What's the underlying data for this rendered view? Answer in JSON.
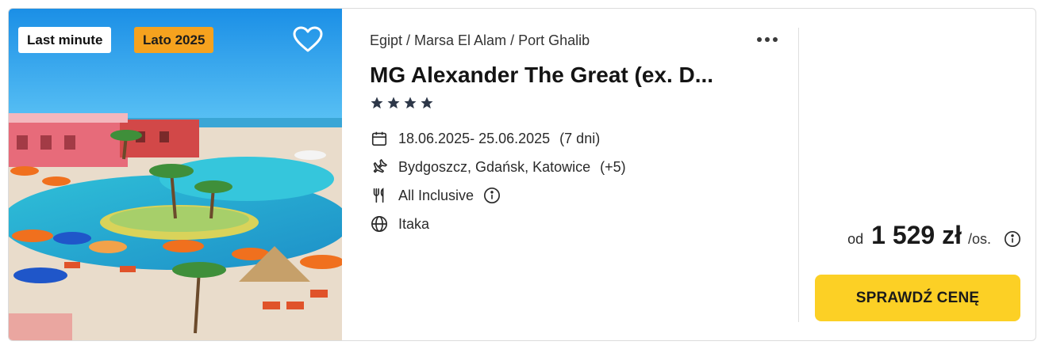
{
  "badges": {
    "last_minute": "Last minute",
    "season": "Lato 2025"
  },
  "colors": {
    "season_badge": "#f6a21e",
    "cta": "#fcd025",
    "stars": "#2d3748"
  },
  "breadcrumb": "Egipt / Marsa El Alam / Port Ghalib",
  "hotel": {
    "name": "MG Alexander The Great (ex. D...",
    "stars": 4
  },
  "dates": {
    "range": "18.06.2025- 25.06.2025",
    "duration": "(7 dni)"
  },
  "airports": {
    "list": "Bydgoszcz, Gdańsk, Katowice",
    "more": "(+5)"
  },
  "board": "All Inclusive",
  "operator": "Itaka",
  "price": {
    "prefix": "od",
    "amount": "1 529 zł",
    "per": "/os."
  },
  "cta_label": "SPRAWDŹ CENĘ",
  "icons": [
    "heart-icon",
    "more-dots-icon",
    "star-icon",
    "calendar-icon",
    "plane-icon",
    "cutlery-icon",
    "info-icon",
    "globe-icon"
  ]
}
